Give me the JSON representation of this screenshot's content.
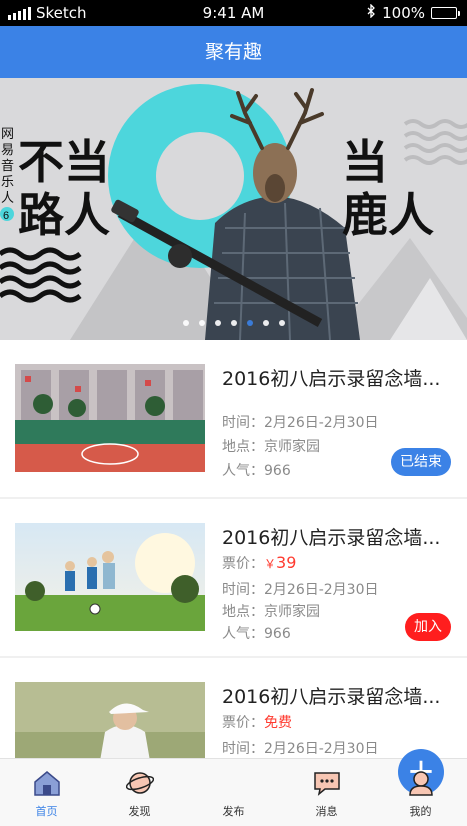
{
  "status_bar": {
    "carrier": "Sketch",
    "time": "9:41 AM",
    "battery": "100%"
  },
  "nav": {
    "title": "聚有趣"
  },
  "banner": {
    "left_headline_1": "不当",
    "left_headline_2": "路人",
    "right_headline_1": "当",
    "right_headline_2": "鹿人",
    "vertical_text": [
      "网",
      "易",
      "音",
      "乐",
      "人"
    ],
    "badge": "6",
    "slide_count": 7,
    "active_slide": 5
  },
  "events": [
    {
      "title": "2016初八启示录留念墙...",
      "time_label": "时间：",
      "time": "2月26日-2月30日",
      "place_label": "地点：",
      "place": "京师家园",
      "popularity_label": "人气：",
      "popularity": "966",
      "action": "已结束"
    },
    {
      "title": "2016初八启示录留念墙...",
      "price_label": "票价：",
      "currency": "￥",
      "price": "39",
      "time_label": "时间：",
      "time": "2月26日-2月30日",
      "place_label": "地点：",
      "place": "京师家园",
      "popularity_label": "人气：",
      "popularity": "966",
      "action": "加入"
    },
    {
      "title": "2016初八启示录留念墙...",
      "price_label": "票价：",
      "price": "免费",
      "time_label": "时间：",
      "time": "2月26日-2月30日"
    }
  ],
  "tabs": [
    {
      "label": "首页",
      "icon": "home-icon"
    },
    {
      "label": "发现",
      "icon": "planet-icon"
    },
    {
      "label": "发布",
      "icon": "plus-icon"
    },
    {
      "label": "消息",
      "icon": "message-icon"
    },
    {
      "label": "我的",
      "icon": "user-icon"
    }
  ],
  "colors": {
    "primary": "#3b82e6",
    "accent_red": "#ff1e1e",
    "price_red": "#ff3b30",
    "banner_cyan": "#4dd6dc"
  }
}
